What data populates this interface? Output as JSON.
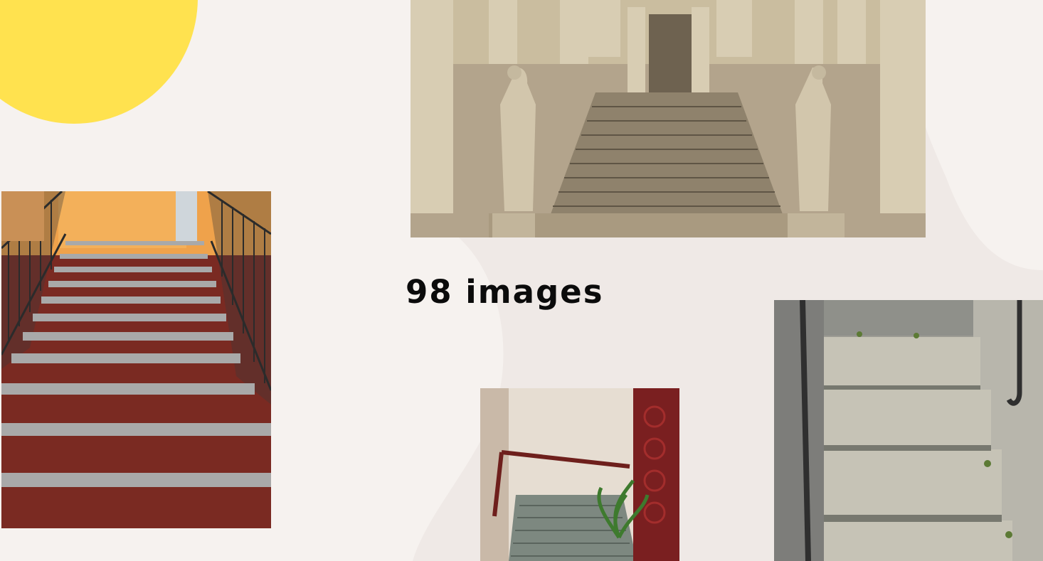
{
  "slide": {
    "title": "98 images"
  },
  "decor": {
    "sun_color": "#ffe24f",
    "background_color": "#f6f2ef"
  },
  "images": [
    {
      "name": "red-staircase-photo",
      "icon": "staircase-photo"
    },
    {
      "name": "palace-staircase-statues-photo",
      "icon": "staircase-photo"
    },
    {
      "name": "spiral-staircase-plant-photo",
      "icon": "staircase-photo"
    },
    {
      "name": "stone-steps-railing-photo",
      "icon": "staircase-photo"
    }
  ]
}
